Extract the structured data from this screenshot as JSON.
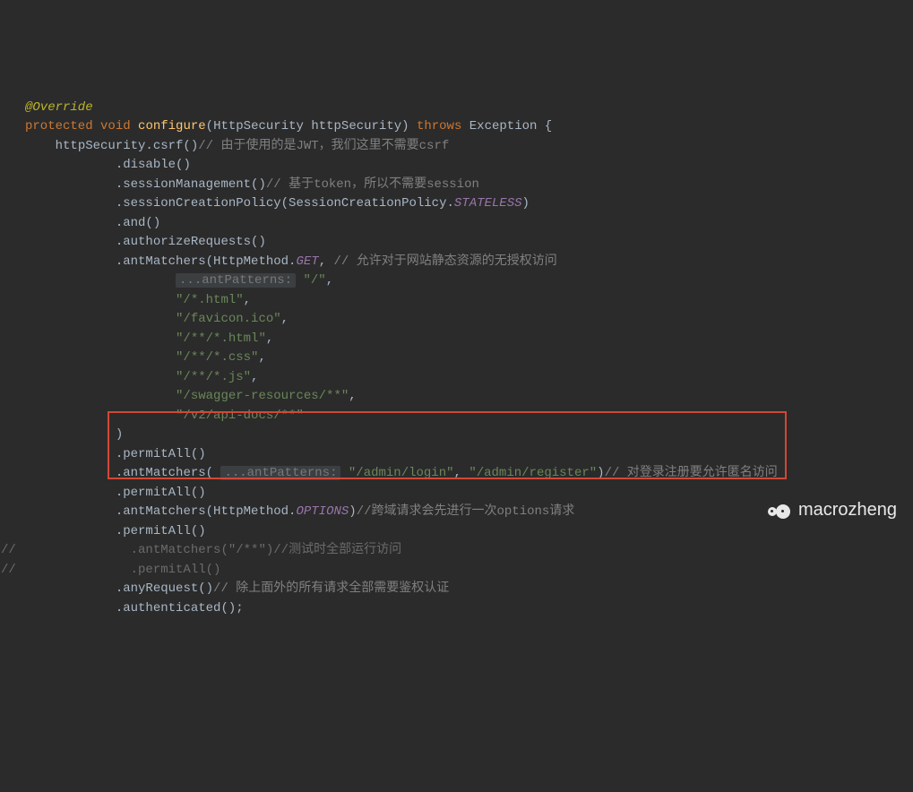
{
  "code": {
    "annotation": "@Override",
    "kw_protected": "protected",
    "kw_void": "void",
    "method_name": "configure",
    "param_type": "HttpSecurity",
    "param_name": "httpSecurity",
    "kw_throws": "throws",
    "exc_type": "Exception",
    "brace_open": " {",
    "l3_p1": "httpSecurity.csrf()",
    "l3_c": "// 由于使用的是JWT，我们这里不需要csrf",
    "l4": ".disable()",
    "l5_p1": ".sessionManagement()",
    "l5_c": "// 基于token，所以不需要session",
    "l6_p1": ".sessionCreationPolicy(SessionCreationPolicy.",
    "l6_const": "STATELESS",
    "l6_p2": ")",
    "l7": ".and()",
    "l8": ".authorizeRequests()",
    "l9_p1": ".antMatchers(HttpMethod.",
    "l9_const": "GET",
    "l9_p2": ", ",
    "l9_c": "// 允许对于网站静态资源的无授权访问",
    "l10_hint": "...antPatterns:",
    "l10_s": "\"/\"",
    "l11_s": "\"/*.html\"",
    "l12_s": "\"/favicon.ico\"",
    "l13_s": "\"/**/*.html\"",
    "l14_s": "\"/**/*.css\"",
    "l15_s": "\"/**/*.js\"",
    "l16_s": "\"/swagger-resources/**\"",
    "l17_s": "\"/v2/api-docs/**\"",
    "l18": ")",
    "l19": ".permitAll()",
    "l20_p1": ".antMatchers( ",
    "l20_hint": "...antPatterns:",
    "l20_s1": "\"/admin/login\"",
    "l20_s2": "\"/admin/register\"",
    "l20_p2": ")",
    "l20_c": "// 对登录注册要允许匿名访问",
    "l21": ".permitAll()",
    "l22_p1": ".antMatchers(HttpMethod.",
    "l22_const": "OPTIONS",
    "l22_p2": ")",
    "l22_c": "//跨域请求会先进行一次options请求",
    "l23": ".permitAll()",
    "dbl_slash": "//",
    "l24_p1": ".antMatchers(",
    "l24_s": "\"/**\"",
    "l24_p2": ")",
    "l24_c": "//测试时全部运行访问",
    "l25": ".permitAll()",
    "l26_p1": ".anyRequest()",
    "l26_c": "// 除上面外的所有请求全部需要鉴权认证",
    "l27": ".authenticated();"
  },
  "watermark": "macrozheng"
}
